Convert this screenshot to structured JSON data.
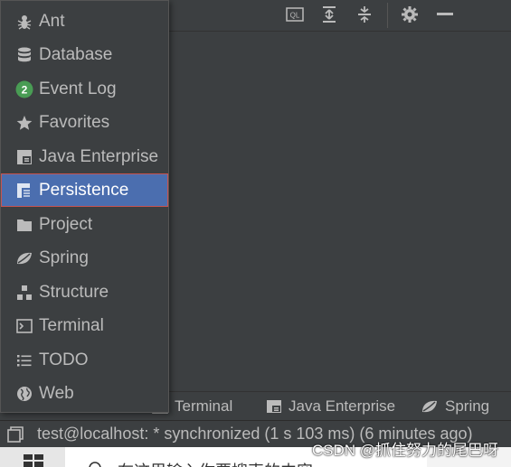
{
  "toolwindows": {
    "items": [
      {
        "label": "Ant",
        "icon": "ant-icon"
      },
      {
        "label": "Database",
        "icon": "database-icon"
      },
      {
        "label": "Event Log",
        "icon": "event-log-icon",
        "badge": "2"
      },
      {
        "label": "Favorites",
        "icon": "star-icon"
      },
      {
        "label": "Java Enterprise",
        "icon": "java-enterprise-icon"
      },
      {
        "label": "Persistence",
        "icon": "persistence-icon",
        "selected": true
      },
      {
        "label": "Project",
        "icon": "folder-icon"
      },
      {
        "label": "Spring",
        "icon": "spring-leaf-icon"
      },
      {
        "label": "Structure",
        "icon": "structure-icon"
      },
      {
        "label": "Terminal",
        "icon": "terminal-icon"
      },
      {
        "label": "TODO",
        "icon": "todo-list-icon"
      },
      {
        "label": "Web",
        "icon": "globe-icon"
      }
    ]
  },
  "toolstrip": {
    "terminal_label": "Terminal",
    "java_enterprise_label": "Java Enterprise",
    "spring_label": "Spring"
  },
  "topbar": {
    "ql_label": "QL"
  },
  "status": {
    "text": "test@localhost: * synchronized (1 s 103 ms) (6 minutes ago)"
  },
  "taskbar": {
    "search_text": "在这里输入你要搜索的内容"
  },
  "watermark": "CSDN @抓住努力的尾巴呀",
  "colors": {
    "selection": "#4b6eaf",
    "selection_border": "#c75450",
    "badge_green": "#499c54"
  }
}
